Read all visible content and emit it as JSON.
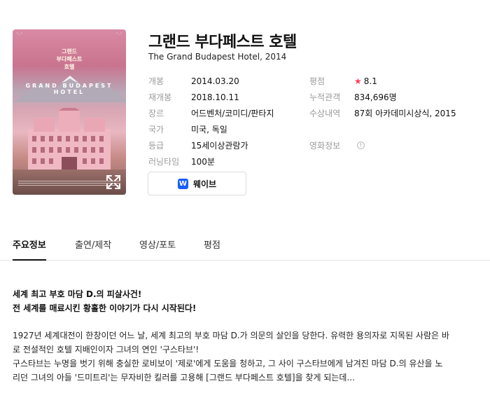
{
  "poster": {
    "tagline_left": "\"...\"",
    "tagline_right": "\"...\"",
    "title_lines": [
      "그랜드",
      "부다페스트",
      "호텔"
    ],
    "arch_text": "GRAND BUDAPEST HOTEL"
  },
  "movie": {
    "title": "그랜드 부다페스트 호텔",
    "subtitle": "The Grand Budapest Hotel, 2014"
  },
  "info_left": [
    {
      "key": "개봉",
      "value": "2014.03.20"
    },
    {
      "key": "재개봉",
      "value": "2018.10.11"
    },
    {
      "key": "장르",
      "value": "어드벤처/코미디/판타지"
    },
    {
      "key": "국가",
      "value": "미국, 독일"
    },
    {
      "key": "등급",
      "value": "15세이상관람가"
    },
    {
      "key": "러닝타임",
      "value": "100분"
    }
  ],
  "info_right": {
    "rating_key": "평점",
    "rating_value": "8.1",
    "audience_key": "누적관객",
    "audience_value": "834,696명",
    "awards_key": "수상내역",
    "awards_value": "87회 아카데미시상식, 2015",
    "movieinfo_key": "영화정보"
  },
  "wave_button": {
    "logo": "W",
    "label": "웨이브"
  },
  "tabs": [
    "주요정보",
    "출연/제작",
    "영상/포토",
    "평점"
  ],
  "intro": {
    "headline1": "세계 최고 부호 마담 D.의 피살사건!",
    "headline2": "전 세계를 매료시킨 황홀한 이야기가 다시 시작된다!",
    "line1": "1927년 세계대전이 한창이던 어느 날, 세계 최고의 부호 마담 D.가 의문의 살인을 당한다. 유력한 용의자로 지목된 사람은 바",
    "line2": "로 전설적인 호텔 지배인이자 그녀의 연인 '구스타브'!",
    "line3": "구스타브는 누명을 벗기 위해 충실한 로비보이 '제로'에게 도움을 청하고, 그 사이 구스타브에게 남겨진 마담 D.의 유산을 노",
    "line4": "리던 그녀의 아들 '드미트리'는 무자비한 킬러를 고용해 [그랜드 부다페스트 호텔]을 찾게 되는데..."
  },
  "colors": {
    "accent_star": "#ff3b5c",
    "link": "#2f6fd0",
    "wave_brand": "#1a5dff"
  }
}
